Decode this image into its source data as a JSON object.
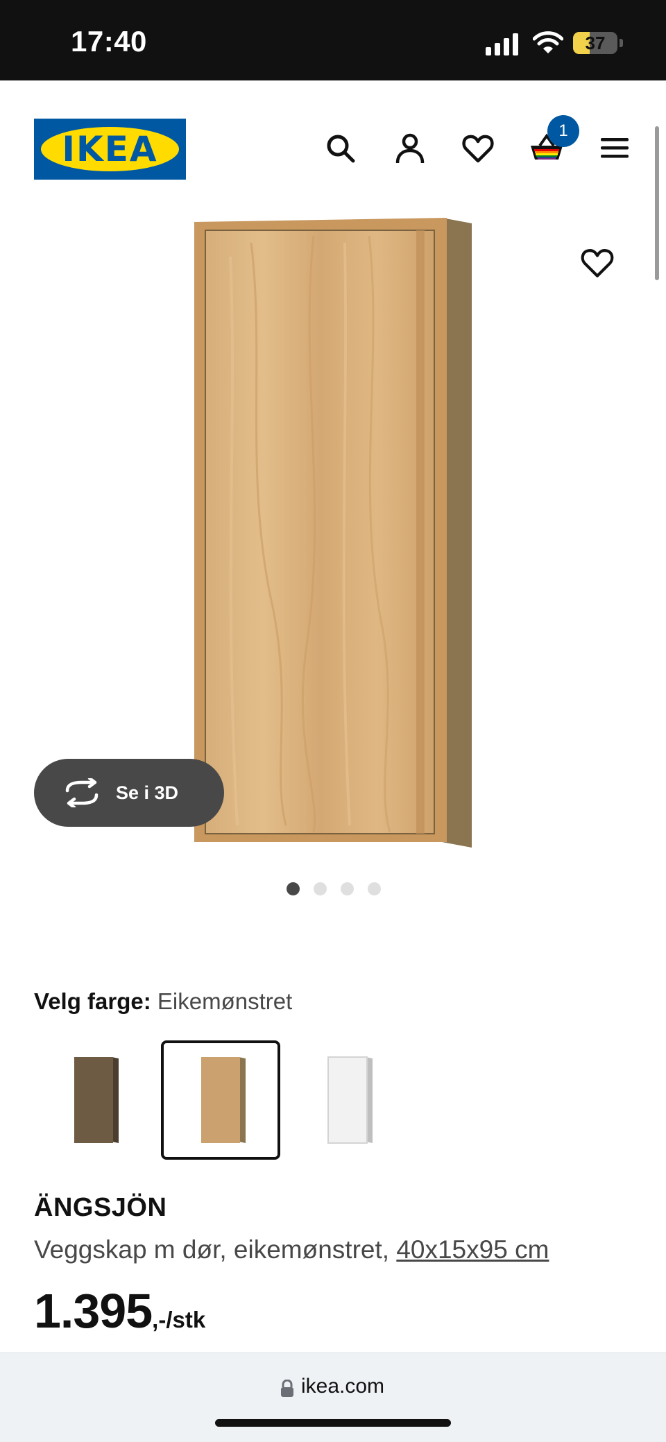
{
  "status_bar": {
    "time": "17:40",
    "battery_level": "37",
    "battery_percent": 37
  },
  "header": {
    "logo_text": "IKEA",
    "icons": [
      "search-icon",
      "profile-icon",
      "favourites-icon",
      "cart-icon",
      "menu-icon"
    ],
    "cart_count": "1",
    "brand_blue": "#0058a3",
    "brand_yellow": "#ffdb00"
  },
  "gallery": {
    "view_3d_label": "Se i 3D",
    "slide_count": 4,
    "active_slide": 1
  },
  "color_selector": {
    "label": "Velg farge:",
    "selected": "Eikemønstret",
    "swatch_colors": [
      "#6e5b44",
      "#caa16f",
      "#f2f2f2"
    ],
    "selected_index": 1
  },
  "product": {
    "name": "ÄNGSJÖN",
    "description": "Veggskap m dør, eikemønstret, ",
    "size": "40x15x95 cm",
    "price": "1.395",
    "price_unit": ",-/stk"
  },
  "browser": {
    "url": "ikea.com"
  }
}
